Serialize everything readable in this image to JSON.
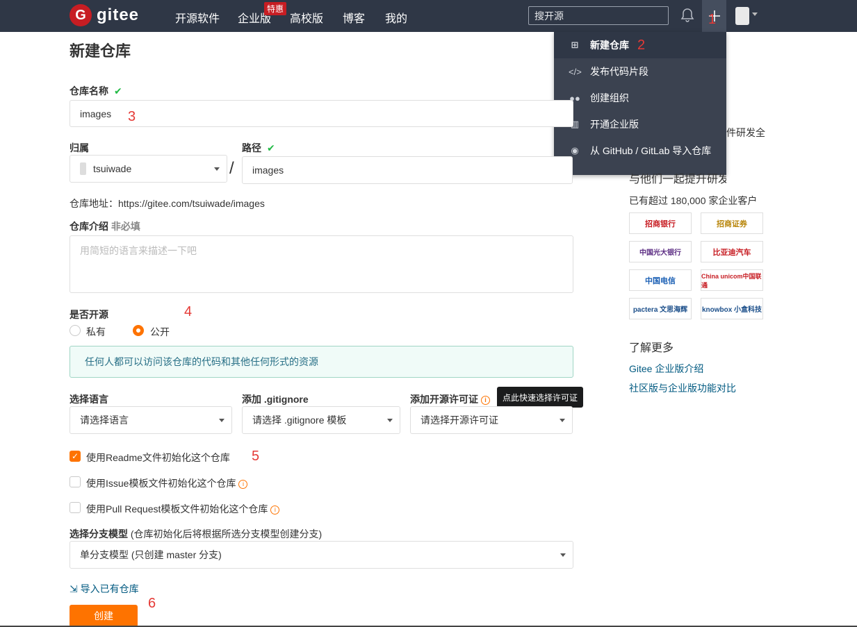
{
  "nav": {
    "logo_letter": "G",
    "logo_text": "gitee",
    "items": [
      "开源软件",
      "企业版",
      "高校版",
      "博客",
      "我的"
    ],
    "badge": "特惠",
    "search_placeholder": "搜开源"
  },
  "markers": [
    "1",
    "2",
    "3",
    "4",
    "5",
    "6"
  ],
  "dropdown": {
    "items": [
      {
        "label": "新建仓库",
        "icon": "plus-square-icon"
      },
      {
        "label": "发布代码片段",
        "icon": "code-icon"
      },
      {
        "label": "创建组织",
        "icon": "users-icon"
      },
      {
        "label": "开通企业版",
        "icon": "building-icon"
      },
      {
        "label": "从 GitHub / GitLab 导入仓库",
        "icon": "github-icon"
      }
    ]
  },
  "form": {
    "title": "新建仓库",
    "name_label": "仓库名称",
    "name_value": "images",
    "owner_label": "归属",
    "owner_value": "tsuiwade",
    "path_label": "路径",
    "path_value": "images",
    "slash": "/",
    "address_text": "仓库地址：https://gitee.com/tsuiwade/images",
    "intro_label": "仓库介绍",
    "intro_optional": "非必填",
    "intro_placeholder": "用简短的语言来描述一下吧",
    "open_label": "是否开源",
    "private_label": "私有",
    "public_label": "公开",
    "public_selected": true,
    "public_info": "任何人都可以访问该仓库的代码和其他任何形式的资源",
    "lang_label": "选择语言",
    "lang_value": "请选择语言",
    "gitignore_label": "添加 .gitignore",
    "gitignore_value": "请选择 .gitignore 模板",
    "license_label": "添加开源许可证",
    "license_value": "请选择开源许可证",
    "license_tooltip": "点此快速选择许可证",
    "readme_label": "使用Readme文件初始化这个仓库",
    "readme_checked": true,
    "issue_label": "使用Issue模板文件初始化这个仓库",
    "issue_checked": false,
    "pr_label": "使用Pull Request模板文件初始化这个仓库",
    "pr_checked": false,
    "branch_label": "选择分支模型",
    "branch_hint": "(仓库初始化后将根据所选分支模型创建分支)",
    "branch_value": "单分支模型 (只创建 master 分支)",
    "import_link": "导入已有仓库",
    "create_button": "创建"
  },
  "sidebar": {
    "partial_line1": "件研发全",
    "partial_line2": "与他们一起提升研发效能",
    "customers": "已有超过 180,000 家企业客户",
    "logos": [
      "招商银行",
      "招商证券",
      "中国光大银行",
      "比亚迪汽车",
      "中国电信",
      "China unicom中国联通",
      "pactera 文思海辉",
      "knowbox 小盒科技"
    ],
    "learn_more": "了解更多",
    "links": [
      "Gitee 企业版介绍",
      "社区版与企业版功能对比"
    ]
  },
  "colors": {
    "brand": "#c71d23",
    "accent": "#fe7300",
    "topbar": "#2f3746",
    "link": "#005980"
  }
}
